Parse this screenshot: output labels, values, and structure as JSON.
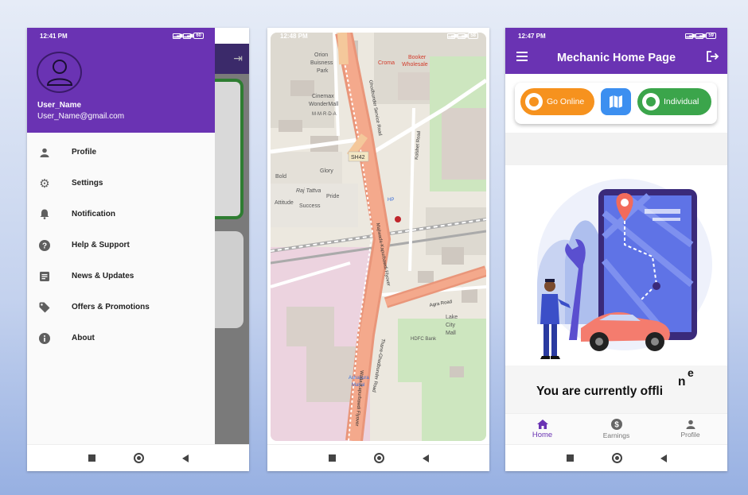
{
  "colors": {
    "primary": "#6a33b3",
    "go_online": "#f6921e",
    "map_button": "#3c8ff0",
    "individual": "#3ba54b"
  },
  "screen_drawer": {
    "status": {
      "time": "12:41 PM",
      "battery": "60"
    },
    "user": {
      "name": "User_Name",
      "email": "User_Name@gmail.com"
    },
    "menu": [
      {
        "label": "Profile",
        "icon": "person-icon"
      },
      {
        "label": "Settings",
        "icon": "gear-icon"
      },
      {
        "label": "Notification",
        "icon": "bell-icon"
      },
      {
        "label": "Help & Support",
        "icon": "help-icon"
      },
      {
        "label": "News & Updates",
        "icon": "news-icon"
      },
      {
        "label": "Offers & Promotions",
        "icon": "tag-icon"
      },
      {
        "label": "About",
        "icon": "info-icon"
      }
    ]
  },
  "screen_map": {
    "status": {
      "time": "12:48 PM",
      "battery": "58"
    },
    "labels": {
      "orion": "Orion",
      "busness": "Buisness",
      "park": "Park",
      "croma": "Croma",
      "booker1": "Booker",
      "booker2": "Wholesale",
      "cinemax1": "Cinemax",
      "cinemax2": "WonderMall",
      "mmrda": "M·M·R·D·A",
      "sh42": "SH42",
      "ghodbunder": "Ghodbunder Service Road",
      "kolshet": "Kolshet Road",
      "bold": "Bold",
      "glory": "Glory",
      "rajtattva": "Raj Tattva",
      "pride": "Pride",
      "attitude": "Attitude",
      "success": "Success",
      "hp": "HP",
      "majiwada": "Majiwada-Kapurbawdi Flyover",
      "agra": "Agra Road",
      "lake1": "Lake",
      "lake2": "City",
      "lake3": "Mall",
      "hdfc": "HDFC Bank",
      "ashapura1": "Ashapura",
      "ashapura2": "Mahal",
      "thane": "Thane-Ghodbunder Road",
      "flyover2": "Wada-Kapurbawdi Flyover"
    }
  },
  "screen_home": {
    "status": {
      "time": "12:47 PM",
      "battery": "59"
    },
    "title": "Mechanic Home Page",
    "go_online": "Go Online",
    "individual": "Individual",
    "offline_text": "You are currently offli",
    "offline_n": "n",
    "offline_e": "e",
    "nav": [
      {
        "label": "Home",
        "icon": "home-icon"
      },
      {
        "label": "Earnings",
        "icon": "dollar-icon"
      },
      {
        "label": "Profile",
        "icon": "person-icon"
      }
    ]
  }
}
